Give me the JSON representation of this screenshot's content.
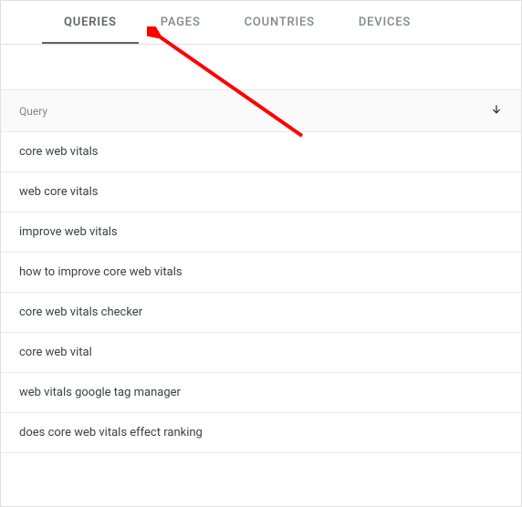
{
  "tabs": [
    {
      "label": "QUERIES",
      "active": true
    },
    {
      "label": "PAGES",
      "active": false
    },
    {
      "label": "COUNTRIES",
      "active": false
    },
    {
      "label": "DEVICES",
      "active": false
    }
  ],
  "table": {
    "header": "Query",
    "rows": [
      "core web vitals",
      "web core vitals",
      "improve web vitals",
      "how to improve core web vitals",
      "core web vitals checker",
      "core web vital",
      "web vitals google tag manager",
      "does core web vitals effect ranking"
    ]
  }
}
